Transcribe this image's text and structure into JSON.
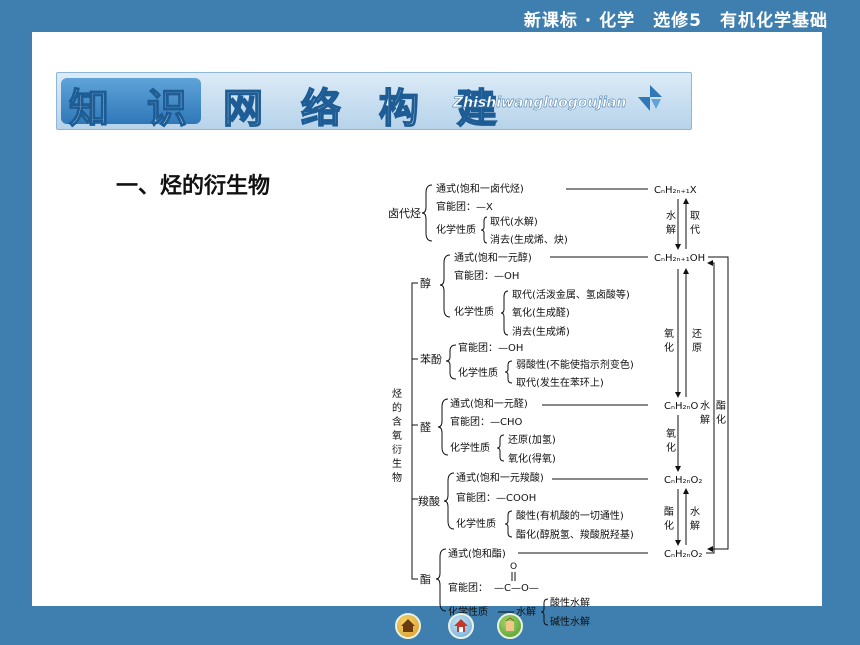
{
  "header": {
    "title": "新课标 · 化学　选修5　有机化学基础"
  },
  "banner": {
    "part1": "知 识",
    "part2": "网 络 构 建",
    "subtitle": "Zhishiwangluogoujian"
  },
  "section": {
    "title": "一、烃的衍生物"
  },
  "diagram": {
    "root_label": "烃的含氧衍生物",
    "haloalkane": {
      "name": "卤代烃",
      "formula": "通式(饱和一卤代烃)",
      "group": "官能团：—X",
      "props_label": "化学性质",
      "props": [
        "取代(水解)",
        "消去(生成烯、炔)"
      ],
      "product": "CₙH₂ₙ₊₁X"
    },
    "alcohol": {
      "name": "醇",
      "formula": "通式(饱和一元醇)",
      "group": "官能团：—OH",
      "props_label": "化学性质",
      "props": [
        "取代(活泼金属、氢卤酸等)",
        "氧化(生成醛)",
        "消去(生成烯)"
      ],
      "product": "CₙH₂ₙ₊₁OH"
    },
    "phenol": {
      "name": "苯酚",
      "group": "官能团：—OH",
      "props_label": "化学性质",
      "props": [
        "弱酸性(不能使指示剂变色)",
        "取代(发生在苯环上)"
      ]
    },
    "aldehyde": {
      "name": "醛",
      "formula": "通式(饱和一元醛)",
      "group": "官能团：—CHO",
      "props_label": "化学性质",
      "props": [
        "还原(加氢)",
        "氧化(得氧)"
      ],
      "product": "CₙH₂ₙO"
    },
    "acid": {
      "name": "羧酸",
      "formula": "通式(饱和一元羧酸)",
      "group": "官能团：—COOH",
      "props_label": "化学性质",
      "props": [
        "酸性(有机酸的一切通性)",
        "酯化(醇脱氢、羧酸脱羟基)"
      ],
      "product": "CₙH₂ₙO₂"
    },
    "ester": {
      "name": "酯",
      "formula": "通式(饱和酯)",
      "group_label": "官能团：",
      "group_o": "O",
      "group_chain": "—C—O—",
      "props_label": "化学性质",
      "hydrolysis": "水解",
      "props": [
        "酸性水解",
        "碱性水解"
      ],
      "product": "CₙH₂ₙO₂"
    },
    "arrows": {
      "water_1": "水",
      "water_2": "解",
      "sub_1": "取",
      "sub_2": "代",
      "ox_1": "氧",
      "ox_2": "化",
      "red_1": "还",
      "red_2": "原",
      "ox2_1": "氧",
      "ox2_2": "化",
      "est_1": "酯",
      "est_2": "化",
      "hyd_1": "水",
      "hyd_2": "解",
      "outer_hyd_1": "水",
      "outer_hyd_2": "解",
      "outer_est_1": "酯",
      "outer_est_2": "化"
    }
  },
  "nav": {
    "items": [
      {
        "name": "home-button"
      },
      {
        "name": "menu-button"
      },
      {
        "name": "next-button"
      }
    ]
  },
  "colors": {
    "background": "#3f7fb0",
    "banner_blue": "#2f78b8"
  }
}
